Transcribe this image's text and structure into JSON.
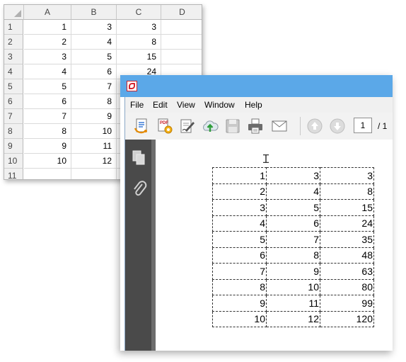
{
  "spreadsheet": {
    "columns": [
      "A",
      "B",
      "C",
      "D"
    ],
    "rows": [
      {
        "row": "1",
        "cells": [
          "1",
          "3",
          "3",
          ""
        ]
      },
      {
        "row": "2",
        "cells": [
          "2",
          "4",
          "8",
          ""
        ]
      },
      {
        "row": "3",
        "cells": [
          "3",
          "5",
          "15",
          ""
        ]
      },
      {
        "row": "4",
        "cells": [
          "4",
          "6",
          "24",
          ""
        ]
      },
      {
        "row": "5",
        "cells": [
          "5",
          "7",
          "",
          ""
        ]
      },
      {
        "row": "6",
        "cells": [
          "6",
          "8",
          "",
          ""
        ]
      },
      {
        "row": "7",
        "cells": [
          "7",
          "9",
          "",
          ""
        ]
      },
      {
        "row": "8",
        "cells": [
          "8",
          "10",
          "",
          ""
        ]
      },
      {
        "row": "9",
        "cells": [
          "9",
          "11",
          "",
          ""
        ]
      },
      {
        "row": "10",
        "cells": [
          "10",
          "12",
          "",
          ""
        ]
      },
      {
        "row": "11",
        "cells": [
          "",
          "",
          "",
          ""
        ]
      }
    ]
  },
  "pdf_window": {
    "menu": [
      "File",
      "Edit",
      "View",
      "Window",
      "Help"
    ],
    "toolbar_icons": [
      "create-pdf-icon",
      "convert-icon",
      "sign-icon",
      "upload-icon",
      "save-icon",
      "print-icon",
      "email-icon",
      "previous-page-icon",
      "next-page-icon"
    ],
    "page_number": "1",
    "page_total": "/ 1",
    "table": [
      [
        "1",
        "3",
        "3"
      ],
      [
        "2",
        "4",
        "8"
      ],
      [
        "3",
        "5",
        "15"
      ],
      [
        "4",
        "6",
        "24"
      ],
      [
        "5",
        "7",
        "35"
      ],
      [
        "6",
        "8",
        "48"
      ],
      [
        "7",
        "9",
        "63"
      ],
      [
        "8",
        "10",
        "80"
      ],
      [
        "9",
        "11",
        "99"
      ],
      [
        "10",
        "12",
        "120"
      ]
    ]
  },
  "colors": {
    "title_bar": "#5ba8e8",
    "nav_panel": "#4a4a4a",
    "sheet_header": "#f0f0f0",
    "gridline": "#dadada"
  }
}
